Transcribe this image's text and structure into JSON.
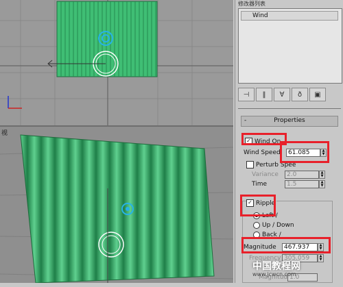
{
  "panel": {
    "modifier_list_label": "修改器列表",
    "stack_item": "Wind",
    "rollout_title": "Properties",
    "wind_on": "Wind On",
    "wind_speed_label": "Wind Speed",
    "wind_speed_value": "61.085",
    "perturb_label": "Perturb Spee",
    "variance_label": "Variance",
    "variance_value": "2.0",
    "time_label": "Time",
    "time_value": "1.5",
    "ripple_label": "Ripple",
    "left_label": "Left /",
    "updown_label": "Up / Down",
    "back_label": "Back /",
    "magnitude_label": "Magnitude",
    "magnitude_value": "467.937",
    "frequency_label": "Frequency",
    "frequency_value": "305.059",
    "magnitude2_label": "Magnitud",
    "magnitude2_value": "1.0"
  },
  "viewport": {
    "perspective_label": "视"
  },
  "watermark": {
    "text": "中国教程网",
    "url": "www.jcwcn.com"
  },
  "colors": {
    "cloth": "#3fbe74",
    "highlight": "#e8202a"
  }
}
